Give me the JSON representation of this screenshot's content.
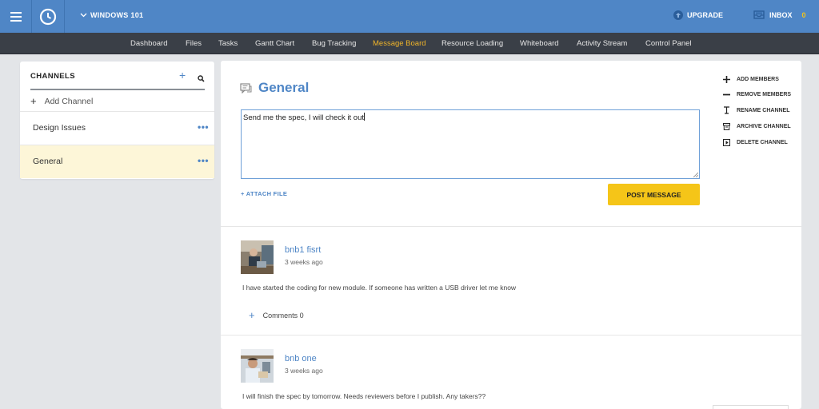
{
  "topbar": {
    "workspace": "WINDOWS 101",
    "upgrade": "UPGRADE",
    "inbox": "INBOX",
    "inbox_count": "0"
  },
  "nav": {
    "tabs": [
      {
        "label": "Dashboard"
      },
      {
        "label": "Files"
      },
      {
        "label": "Tasks"
      },
      {
        "label": "Gantt Chart"
      },
      {
        "label": "Bug Tracking"
      },
      {
        "label": "Message Board",
        "active": true
      },
      {
        "label": "Resource Loading"
      },
      {
        "label": "Whiteboard"
      },
      {
        "label": "Activity Stream"
      },
      {
        "label": "Control Panel"
      }
    ]
  },
  "channels": {
    "title": "CHANNELS",
    "add_channel": "Add Channel",
    "items": [
      {
        "name": "Design Issues",
        "active": false
      },
      {
        "name": "General",
        "active": true
      }
    ]
  },
  "main": {
    "title": "General",
    "message_value": "Send me the spec, I will check it out",
    "attach_label": "+ ATTACH FILE",
    "post_label": "POST MESSAGE",
    "actions": [
      {
        "label": "ADD MEMBERS",
        "icon": "plus-icon"
      },
      {
        "label": "REMOVE MEMBERS",
        "icon": "minus-icon"
      },
      {
        "label": "RENAME CHANNEL",
        "icon": "text-cursor-icon"
      },
      {
        "label": "ARCHIVE CHANNEL",
        "icon": "archive-icon"
      },
      {
        "label": "DELETE CHANNEL",
        "icon": "delete-icon"
      }
    ],
    "posts": [
      {
        "author": "bnb1 fisrt",
        "time": "3 weeks ago",
        "text": "I have started the coding for new module. If someone has written a USB driver let me know",
        "comments": "Comments 0"
      },
      {
        "author": "bnb one",
        "time": "3 weeks ago",
        "text": "I will finish the spec by tomorrow. Needs reviewers before I publish. Any takers??"
      }
    ]
  },
  "colors": {
    "topbar": "#4f86c6",
    "navbar": "#3a3f47",
    "accent": "#f5c518",
    "link": "#4f86c6",
    "active_channel_bg": "#fdf6d8"
  }
}
